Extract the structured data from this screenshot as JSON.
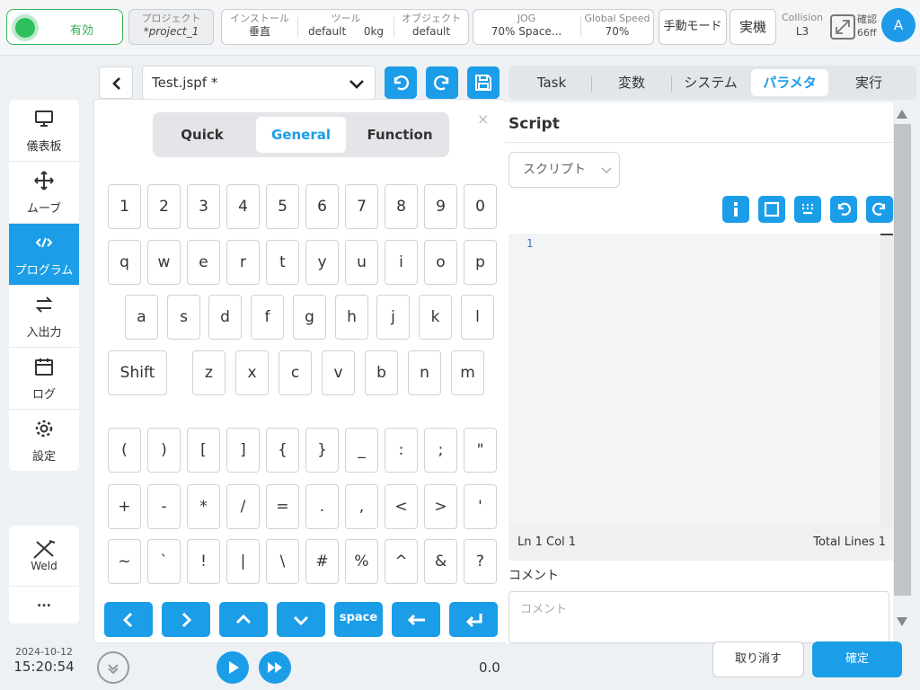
{
  "topbar": {
    "enable_label": "有効",
    "project_caption": "プロジェクト",
    "project_value": "*project_1",
    "install_caption": "インストール",
    "install_value": "垂直",
    "tool_caption": "ツール",
    "tool_value_name": "default",
    "tool_value_load": "0kg",
    "object_caption": "オブジェクト",
    "object_value": "default",
    "jog_caption": "JOG",
    "jog_value": "70%  Space...",
    "speed_caption": "Global Speed",
    "speed_value": "70%",
    "mode_button": "手動モード",
    "real_button": "実機",
    "collision_caption": "Collision",
    "collision_value": "L3",
    "confirm_caption": "確認",
    "confirm_value": "66ff",
    "avatar_letter": "A"
  },
  "leftnav": {
    "items": [
      {
        "label": "儀表板",
        "icon": "monitor-icon"
      },
      {
        "label": "ムーブ",
        "icon": "move-icon"
      },
      {
        "label": "プログラム",
        "icon": "code-icon"
      },
      {
        "label": "入出力",
        "icon": "io-arrows-icon"
      },
      {
        "label": "ログ",
        "icon": "calendar-icon"
      },
      {
        "label": "設定",
        "icon": "gear-icon"
      }
    ],
    "weld_label": "Weld",
    "more_label": "...",
    "date": "2024-10-12",
    "time": "15:20:54"
  },
  "editor": {
    "file_name": "Test.jspf *"
  },
  "keyboard": {
    "tabs": [
      "Quick",
      "General",
      "Function"
    ],
    "active_tab": "General",
    "close_label": "×",
    "row1": [
      "1",
      "2",
      "3",
      "4",
      "5",
      "6",
      "7",
      "8",
      "9",
      "0"
    ],
    "row2": [
      "q",
      "w",
      "e",
      "r",
      "t",
      "y",
      "u",
      "i",
      "o",
      "p"
    ],
    "row3": [
      "a",
      "s",
      "d",
      "f",
      "g",
      "h",
      "j",
      "k",
      "l"
    ],
    "shift_label": "Shift",
    "row4": [
      "z",
      "x",
      "c",
      "v",
      "b",
      "n",
      "m"
    ],
    "row5": [
      "(",
      ")",
      "[",
      "]",
      "{",
      "}",
      "_",
      ":",
      ";",
      "\""
    ],
    "row6": [
      "+",
      "-",
      "*",
      "/",
      "=",
      ".",
      ",",
      "<",
      ">",
      "'"
    ],
    "row7": [
      "~",
      "`",
      "!",
      "|",
      "\\",
      "#",
      "%",
      "^",
      "&",
      "?"
    ],
    "space_label": "space"
  },
  "bottom": {
    "speed_value": "0.0"
  },
  "right": {
    "tabs": [
      "Task",
      "変数",
      "システム",
      "パラメタ",
      "実行"
    ],
    "active_tab": "パラメタ",
    "title": "Script",
    "script_select": "スクリプト",
    "line_number": "1",
    "status_left": "Ln 1 Col 1",
    "status_right": "Total Lines 1",
    "comment_label": "コメント",
    "comment_placeholder": "コメント",
    "cancel_label": "取り消す",
    "ok_label": "確定"
  },
  "colors": {
    "accent": "#1b9de8",
    "enable_green": "#2fbf5f"
  }
}
